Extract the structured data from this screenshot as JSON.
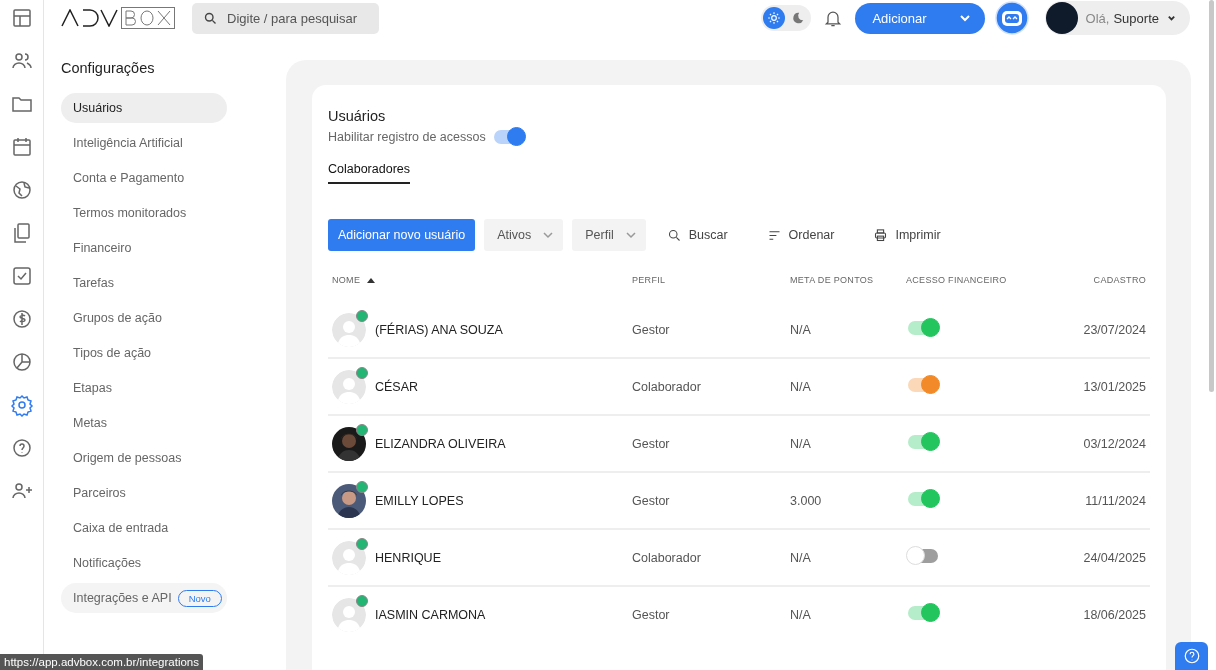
{
  "topbar": {
    "search": {
      "placeholder": "Digite / para pesquisar"
    },
    "dark_mode": false,
    "add_button": "Adicionar",
    "greeting": "Olá,",
    "user": "Suporte"
  },
  "rail": [
    {
      "selected": false
    },
    {
      "selected": false
    },
    {
      "selected": false
    },
    {
      "selected": false
    },
    {
      "selected": false
    },
    {
      "selected": false
    },
    {
      "selected": false
    },
    {
      "selected": false
    },
    {
      "selected": false
    },
    {
      "selected": true
    },
    {
      "selected": false
    },
    {
      "selected": false
    }
  ],
  "settings": {
    "title": "Configurações",
    "items": [
      {
        "label": "Usuários",
        "selected": true
      },
      {
        "label": "Inteligência Artificial",
        "selected": false
      },
      {
        "label": "Conta e Pagamento",
        "selected": false
      },
      {
        "label": "Termos monitorados",
        "selected": false
      },
      {
        "label": "Financeiro",
        "selected": false
      },
      {
        "label": "Tarefas",
        "selected": false
      },
      {
        "label": "Grupos de ação",
        "selected": false
      },
      {
        "label": "Tipos de ação",
        "selected": false
      },
      {
        "label": "Etapas",
        "selected": false
      },
      {
        "label": "Metas",
        "selected": false
      },
      {
        "label": "Origem de pessoas",
        "selected": false
      },
      {
        "label": "Parceiros",
        "selected": false
      },
      {
        "label": "Caixa de entrada",
        "selected": false
      },
      {
        "label": "Notificações",
        "selected": false
      },
      {
        "label": "Integrações e API",
        "selected": false,
        "badge": "Novo"
      }
    ]
  },
  "panel": {
    "title": "Usuários",
    "access_log": {
      "label": "Habilitar registro de acessos",
      "on": true
    },
    "tabs": [
      {
        "label": "Colaboradores",
        "selected": true
      }
    ],
    "toolbar": {
      "add": "Adicionar novo usuário",
      "filters": [
        "Ativos",
        "Perfil"
      ],
      "actions": [
        "Buscar",
        "Ordenar",
        "Imprimir"
      ]
    },
    "table": {
      "columns": [
        "NOME",
        "PERFIL",
        "META DE PONTOS",
        "ACESSO FINANCEIRO",
        "CADASTRO"
      ],
      "rows": [
        {
          "kind": "default",
          "online": true,
          "name": "(FÉRIAS) ANA SOUZA",
          "profile": "Gestor",
          "points": "N/A",
          "finance": {
            "on": true,
            "color": "#22c55e"
          },
          "date": "23/07/2024"
        },
        {
          "kind": "default",
          "online": true,
          "name": "CÉSAR",
          "profile": "Colaborador",
          "points": "N/A",
          "finance": {
            "on": true,
            "color": "#f28a2a"
          },
          "date": "13/01/2025"
        },
        {
          "kind": "picture",
          "online": true,
          "name": "ELIZANDRA OLIVEIRA",
          "profile": "Gestor",
          "points": "N/A",
          "finance": {
            "on": true,
            "color": "#22c55e"
          },
          "date": "03/12/2024"
        },
        {
          "kind": "picture",
          "online": true,
          "name": "EMILLY LOPES",
          "profile": "Gestor",
          "points": "3.000",
          "finance": {
            "on": true,
            "color": "#22c55e"
          },
          "date": "11/11/2024"
        },
        {
          "kind": "default",
          "online": true,
          "name": "HENRIQUE",
          "profile": "Colaborador",
          "points": "N/A",
          "finance": {
            "on": false,
            "color": "#9e9e9e"
          },
          "date": "24/04/2025"
        },
        {
          "kind": "default",
          "online": true,
          "name": "IASMIN CARMONA",
          "profile": "Gestor",
          "points": "N/A",
          "finance": {
            "on": true,
            "color": "#22c55e"
          },
          "date": "18/06/2025"
        }
      ]
    }
  },
  "status_url": "https://app.advbox.com.br/integrations"
}
